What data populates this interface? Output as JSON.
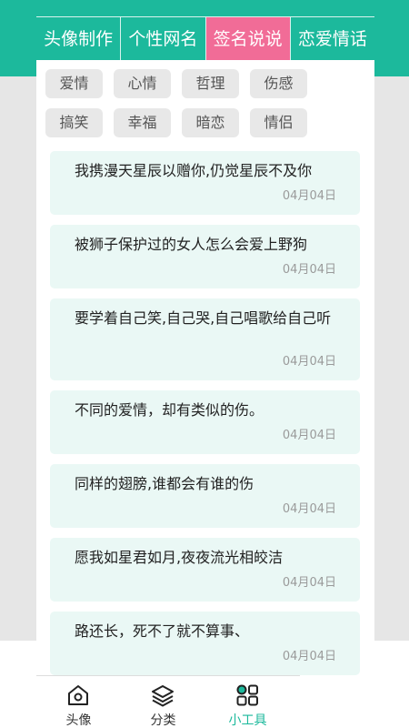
{
  "theme": {
    "primary": "#1cb99c",
    "active_tab": "#f16c97",
    "card_bg": "#eaf8f5"
  },
  "tabs": [
    {
      "label": "头像制作"
    },
    {
      "label": "个性网名"
    },
    {
      "label": "签名说说",
      "active": true
    },
    {
      "label": "恋爱情话"
    }
  ],
  "categories": [
    "爱情",
    "心情",
    "哲理",
    "伤感",
    "搞笑",
    "幸福",
    "暗恋",
    "情侣"
  ],
  "posts": [
    {
      "text": "我携漫天星辰以赠你,仍觉星辰不及你",
      "date": "04月04日"
    },
    {
      "text": "被狮子保护过的女人怎么会爱上野狗",
      "date": "04月04日"
    },
    {
      "text": "要学着自己笑,自己哭,自己唱歌给自己听",
      "date": "04月04日"
    },
    {
      "text": "不同的爱情，却有类似的伤。",
      "date": "04月04日"
    },
    {
      "text": "同样的翅膀,谁都会有谁的伤",
      "date": "04月04日"
    },
    {
      "text": "愿我如星君如月,夜夜流光相皎洁",
      "date": "04月04日"
    },
    {
      "text": "路还长，死不了就不算事、",
      "date": "04月04日"
    }
  ],
  "bottom_nav": [
    {
      "label": "头像",
      "icon": "home-icon"
    },
    {
      "label": "分类",
      "icon": "layers-icon"
    },
    {
      "label": "小工具",
      "icon": "apps-icon",
      "active": true
    }
  ]
}
